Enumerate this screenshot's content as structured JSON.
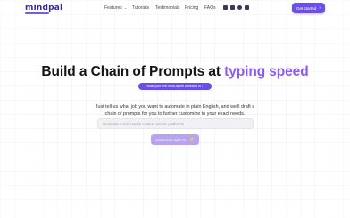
{
  "header": {
    "logo": "mindpal",
    "nav": [
      {
        "label": "Features",
        "has_dropdown": true
      },
      {
        "label": "Tutorials"
      },
      {
        "label": "Testimonials"
      },
      {
        "label": "Pricing"
      },
      {
        "label": "FAQs"
      }
    ],
    "socials": [
      "mail-icon",
      "youtube-icon",
      "facebook-icon",
      "linkedin-icon"
    ],
    "cta_label": "Get started",
    "cta_arrow": "›"
  },
  "hero": {
    "title_main": "Build a Chain of Prompts at ",
    "title_accent": "typing speed",
    "pill_label": "Build your first multi-agent workflow in ↓",
    "description": "Just tell us what job you want to automate in plain English, and we'll draft a chain of prompts for you to further customize to your exact needs.",
    "input_placeholder": "Generate social media content across platforms",
    "generate_label": "Generate with AI",
    "generate_icon": "✨"
  },
  "colors": {
    "accent": "#8a5cf0",
    "brand": "#6d4ee8",
    "button_disabled": "#b7a3f2"
  }
}
